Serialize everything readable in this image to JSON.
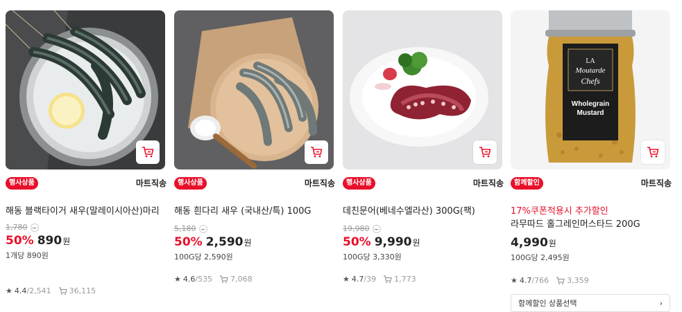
{
  "colors": {
    "accent": "#e8102a",
    "text": "#222222",
    "muted": "#999999"
  },
  "products": [
    {
      "badge": "행사상품",
      "shipping": "마트직송",
      "name": "해동 블랙타이거 새우(말레이시아산)마리",
      "original_price": "1,780",
      "discount": "50%",
      "price": "890",
      "currency": "원",
      "unit_price": "1개당 890원",
      "rating": "4.4",
      "review_count": "2,541",
      "cart_count": "36,115",
      "image": "shrimp-on-ice-icon"
    },
    {
      "badge": "행사상품",
      "shipping": "마트직송",
      "name": "해동 흰다리 새우 (국내산/특) 100G",
      "original_price": "5,180",
      "discount": "50%",
      "price": "2,590",
      "currency": "원",
      "unit_price": "100G당 2,590원",
      "rating": "4.6",
      "review_count": "535",
      "cart_count": "7,068",
      "image": "shrimp-on-board-icon"
    },
    {
      "badge": "행사상품",
      "shipping": "마트직송",
      "name": "데친문어(베네수엘라산) 300G(팩)",
      "original_price": "19,980",
      "discount": "50%",
      "price": "9,990",
      "currency": "원",
      "unit_price": "100G당 3,330원",
      "rating": "4.7",
      "review_count": "39",
      "cart_count": "1,773",
      "image": "octopus-plate-icon"
    },
    {
      "badge": "함께할인",
      "shipping": "마트직송",
      "promo": "17%쿠폰적용시 추가할인",
      "name": "라무따드 홀그레인머스타드 200G",
      "price": "4,990",
      "currency": "원",
      "unit_price": "100G당 2,495원",
      "rating": "4.7",
      "review_count": "766",
      "cart_count": "3,359",
      "combo_button": "함께할인 상품선택",
      "image": "mustard-jar-icon",
      "jar_label": {
        "line1": "LA",
        "line2": "Moutarde",
        "line3": "Chefs",
        "line4": "Wholegrain",
        "line5": "Mustard"
      }
    }
  ]
}
